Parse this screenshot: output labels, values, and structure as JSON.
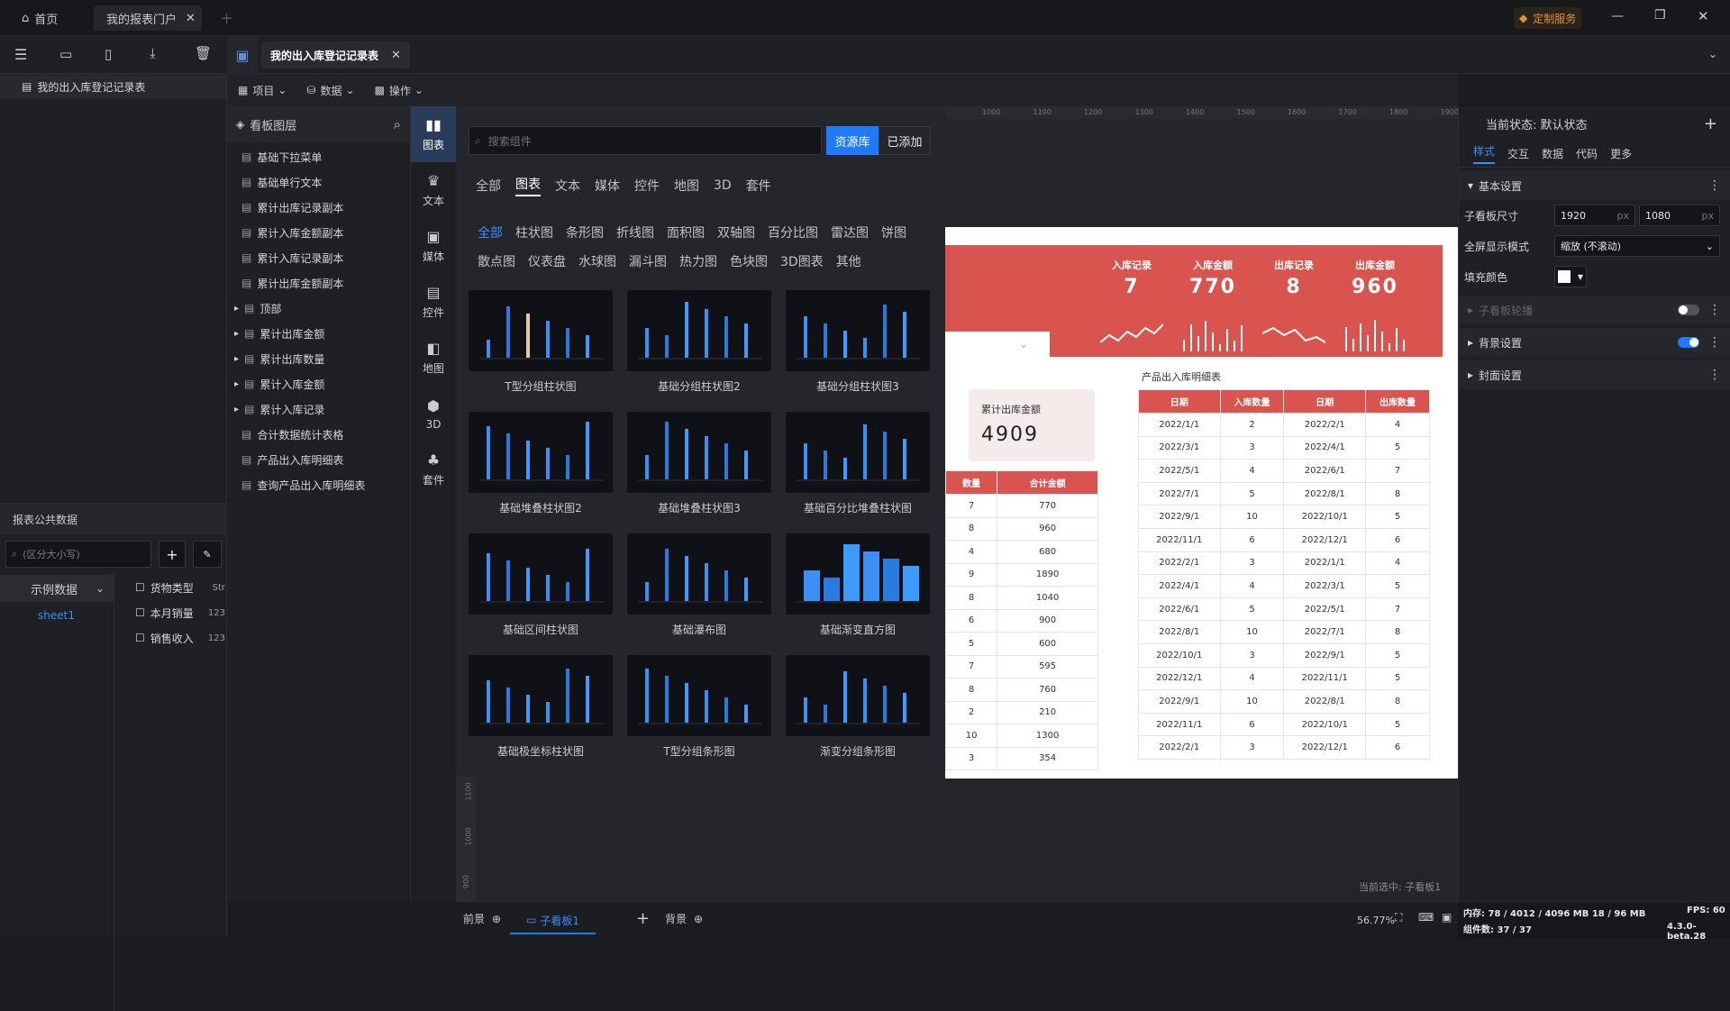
{
  "topbar": {
    "tabs": [
      {
        "label": "首页"
      },
      {
        "label": "我的报表门户"
      }
    ],
    "custom_service": "定制服务"
  },
  "doc_tab": {
    "label": "我的出入库登记记录表"
  },
  "left": {
    "root_item": "我的出入库登记记录表",
    "public_data_title": "报表公共数据",
    "search_placeholder": "(区分大小写)",
    "dataset_select": "示例数据",
    "sheet": "sheet1",
    "fields": [
      {
        "name": "货物类型",
        "type": "Str"
      },
      {
        "name": "本月销量",
        "type": "123"
      },
      {
        "name": "销售收入",
        "type": "123"
      }
    ]
  },
  "menu": {
    "project": "项目",
    "data": "数据",
    "operate": "操作"
  },
  "layers": {
    "title": "看板图层",
    "items": [
      {
        "label": "基础下拉菜单",
        "expandable": false
      },
      {
        "label": "基础单行文本",
        "expandable": false
      },
      {
        "label": "累计出库记录副本",
        "expandable": false
      },
      {
        "label": "累计入库金额副本",
        "expandable": false
      },
      {
        "label": "累计入库记录副本",
        "expandable": false
      },
      {
        "label": "累计出库金额副本",
        "expandable": false
      },
      {
        "label": "顶部",
        "expandable": true
      },
      {
        "label": "累计出库金额",
        "expandable": true
      },
      {
        "label": "累计出库数量",
        "expandable": true
      },
      {
        "label": "累计入库金额",
        "expandable": true
      },
      {
        "label": "累计入库记录",
        "expandable": true
      },
      {
        "label": "合计数据统计表格",
        "expandable": false
      },
      {
        "label": "产品出入库明细表",
        "expandable": false
      },
      {
        "label": "查询产品出入库明细表",
        "expandable": false
      }
    ]
  },
  "rail": [
    {
      "label": "图表",
      "icon": "bar-chart-icon"
    },
    {
      "label": "文本",
      "icon": "text-icon"
    },
    {
      "label": "媒体",
      "icon": "media-icon"
    },
    {
      "label": "控件",
      "icon": "control-icon"
    },
    {
      "label": "地图",
      "icon": "map-icon"
    },
    {
      "label": "3D",
      "icon": "cube-icon"
    },
    {
      "label": "套件",
      "icon": "suite-icon"
    }
  ],
  "library": {
    "search_placeholder": "搜索组件",
    "btn_repo": "资源库",
    "btn_added": "已添加",
    "categories": [
      "全部",
      "图表",
      "文本",
      "媒体",
      "控件",
      "地图",
      "3D",
      "套件"
    ],
    "subcategories_row1": [
      "全部",
      "柱状图",
      "条形图",
      "折线图",
      "面积图",
      "双轴图",
      "百分比图",
      "雷达图",
      "饼图"
    ],
    "subcategories_row2": [
      "散点图",
      "仪表盘",
      "水球图",
      "漏斗图",
      "热力图",
      "色块图",
      "3D图表",
      "其他"
    ],
    "cards": [
      "T型分组柱状图",
      "基础分组柱状图2",
      "基础分组柱状图3",
      "基础堆叠柱状图2",
      "基础堆叠柱状图3",
      "基础百分比堆叠柱状图",
      "基础区间柱状图",
      "基础瀑布图",
      "基础渐变直方图",
      "基础极坐标柱状图",
      "T型分组条形图",
      "渐变分组条形图"
    ]
  },
  "ruler": [
    "1000",
    "1100",
    "1200",
    "1300",
    "1400",
    "1500",
    "1600",
    "1700",
    "1800",
    "1900"
  ],
  "board": {
    "kpis": [
      {
        "label": "入库记录",
        "value": "7"
      },
      {
        "label": "入库金额",
        "value": "770"
      },
      {
        "label": "出库记录",
        "value": "8"
      },
      {
        "label": "出库金额",
        "value": "960"
      }
    ],
    "total_out_label": "累计出库金额",
    "total_out_value": "4909",
    "left_table": {
      "headers": [
        "数量",
        "合计金额"
      ],
      "rows": [
        [
          "7",
          "770"
        ],
        [
          "8",
          "960"
        ],
        [
          "4",
          "680"
        ],
        [
          "9",
          "1890"
        ],
        [
          "8",
          "1040"
        ],
        [
          "6",
          "900"
        ],
        [
          "5",
          "600"
        ],
        [
          "7",
          "595"
        ],
        [
          "8",
          "760"
        ],
        [
          "2",
          "210"
        ],
        [
          "10",
          "1300"
        ],
        [
          "3",
          "354"
        ]
      ]
    },
    "detail_title": "产品出入库明细表",
    "detail_table": {
      "headers": [
        "日期",
        "入库数量",
        "日期",
        "出库数量"
      ],
      "rows": [
        [
          "2022/1/1",
          "2",
          "2022/2/1",
          "4"
        ],
        [
          "2022/3/1",
          "3",
          "2022/4/1",
          "5"
        ],
        [
          "2022/5/1",
          "4",
          "2022/6/1",
          "7"
        ],
        [
          "2022/7/1",
          "5",
          "2022/8/1",
          "8"
        ],
        [
          "2022/9/1",
          "10",
          "2022/10/1",
          "5"
        ],
        [
          "2022/11/1",
          "6",
          "2022/12/1",
          "6"
        ],
        [
          "2022/2/1",
          "3",
          "2022/1/1",
          "4"
        ],
        [
          "2022/4/1",
          "4",
          "2022/3/1",
          "5"
        ],
        [
          "2022/6/1",
          "5",
          "2022/5/1",
          "7"
        ],
        [
          "2022/8/1",
          "10",
          "2022/7/1",
          "8"
        ],
        [
          "2022/10/1",
          "3",
          "2022/9/1",
          "5"
        ],
        [
          "2022/12/1",
          "4",
          "2022/11/1",
          "5"
        ],
        [
          "2022/9/1",
          "10",
          "2022/8/1",
          "8"
        ],
        [
          "2022/11/1",
          "6",
          "2022/10/1",
          "5"
        ],
        [
          "2022/2/1",
          "3",
          "2022/12/1",
          "6"
        ]
      ]
    }
  },
  "canvas": {
    "current_selected": "当前选中: 子看板1",
    "vruler": [
      "1100",
      "1000",
      "900"
    ]
  },
  "bottom": {
    "front": "前景",
    "sub_board": "子看板1",
    "back": "背景",
    "zoom": "56.77%"
  },
  "status": {
    "memory": "内存: 78 / 4012 / 4096 MB  18 / 96 MB",
    "components": "组件数: 37 / 37",
    "fps": "FPS: 60",
    "version": "4.3.0-beta.28"
  },
  "right": {
    "state_label": "当前状态: 默认状态",
    "tabs": [
      "样式",
      "交互",
      "数据",
      "代码",
      "更多"
    ],
    "basic_title": "基本设置",
    "size_label": "子看板尺寸",
    "width": "1920",
    "height": "1080",
    "unit": "px",
    "fullscreen_label": "全屏显示模式",
    "fullscreen_value": "缩放 (不滚动)",
    "fill_label": "填充颜色",
    "carousel_label": "子看板轮播",
    "carousel_on": false,
    "bg_label": "背景设置",
    "bg_on": true,
    "cover_label": "封面设置"
  },
  "colors": {
    "accent": "#1e7bff",
    "red": "#d9534f",
    "brand": "#e0913c"
  }
}
